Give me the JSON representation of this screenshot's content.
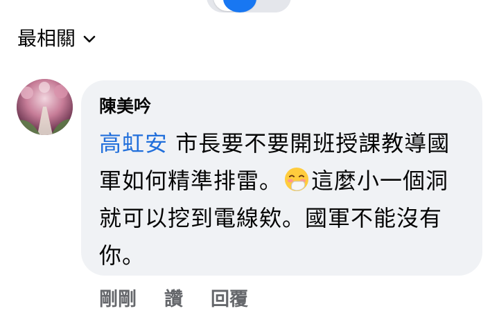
{
  "sort": {
    "label": "最相關",
    "chevron_icon": "chevron-down-icon"
  },
  "comment": {
    "author": "陳美吟",
    "mention": "高虹安",
    "text_part1": " 市長要不要開班授課教導國軍如何精準排雷。",
    "emoji_icon": "face-with-hand-over-mouth-emoji",
    "text_part2": "這麼小一個洞就可以挖到電線欸。國軍不能沒有你。",
    "actions": {
      "time": "剛剛",
      "like": "讚",
      "reply": "回覆"
    }
  },
  "colors": {
    "bubble": "#f0f2f5",
    "mention": "#216fdb",
    "muted": "#65676b",
    "accent": "#1877f2"
  }
}
